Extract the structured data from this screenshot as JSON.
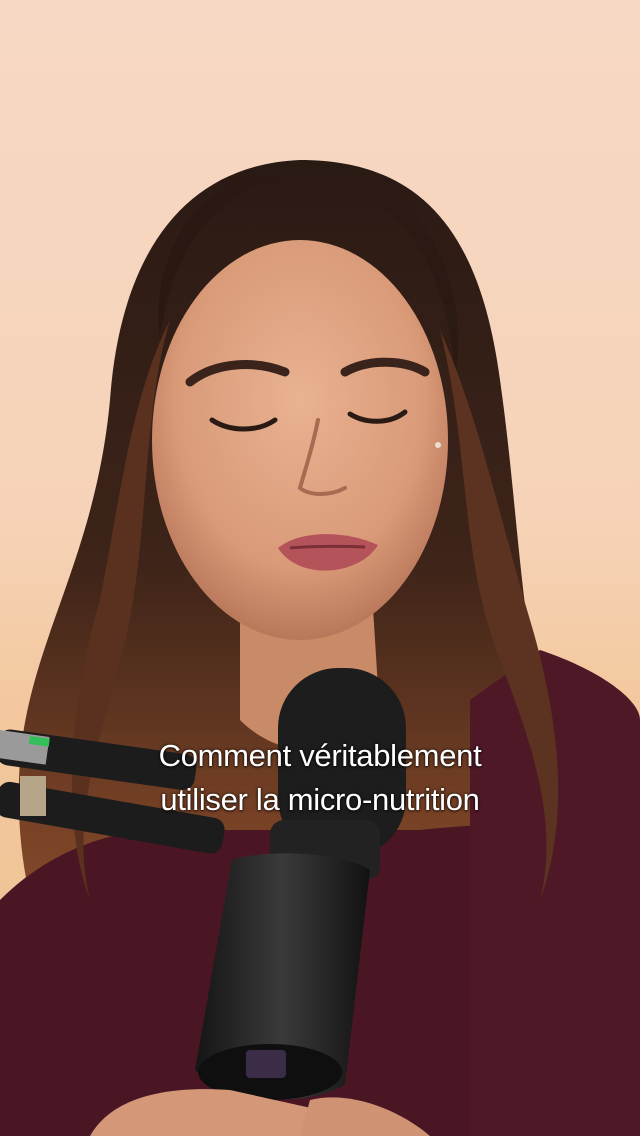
{
  "video": {
    "caption": {
      "line1": "Comment véritablement",
      "line2": "utiliser la micro-nutrition"
    }
  }
}
